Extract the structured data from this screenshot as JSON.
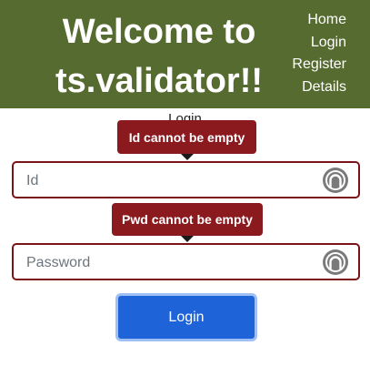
{
  "header": {
    "title_line1": "Welcome to",
    "title_line2": "ts.validator!!",
    "nav": [
      "Home",
      "Login",
      "Register",
      "Details"
    ]
  },
  "form": {
    "title": "Login",
    "id_field": {
      "placeholder": "Id",
      "value": "",
      "error": "Id cannot be empty"
    },
    "password_field": {
      "placeholder": "Password",
      "value": "",
      "error": "Pwd cannot be empty"
    },
    "submit_label": "Login"
  },
  "colors": {
    "header_bg": "#566b2f",
    "error_bg": "#8b1a1f",
    "field_border": "#7b1416",
    "button_bg": "#1f63d8"
  },
  "icons": {
    "field_icon": "password-manager-icon"
  }
}
